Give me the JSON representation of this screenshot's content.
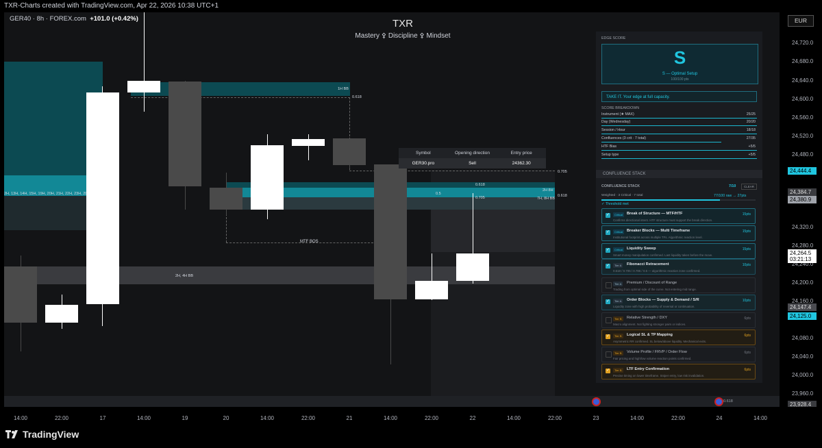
{
  "header": {
    "caption": "TXR-Charts created with TradingView.com, Apr 22, 2026 10:38 UTC+1",
    "symbol": "GER40 · 8h · FOREX.com",
    "change": "+101.0 (+0.42%)",
    "title": "TXR",
    "subtitle": "Mastery ⚴ Discipline ⚴ Mindset",
    "currency": "EUR"
  },
  "colors": {
    "accent": "#20c6e0",
    "zone_teal": "#0c4a52",
    "zone_bright": "#128896",
    "zone_gray": "#3a3b3f",
    "candle_bull": "#ffffff",
    "candle_bear": "#4a4a4a",
    "tier_s_gold": "#e0a020"
  },
  "zones": {
    "zone_1h": "1H BB",
    "zone_2h8h": "2H 8H",
    "zone_2h4h": "2H, 4H BB",
    "zone_7h8h": "7H, 8H BB",
    "left_label": "2H, 13H, 14H, 15H, 19H, 20H, 21H, 22H, 23H, 2D, 1",
    "fib_618_a": "0.618",
    "fib_618_b": "0.618",
    "fib_618_c": "0.618",
    "fib_705_a": "0.705",
    "fib_705_b": "0.705",
    "fib_5": "0.5",
    "mtf_bos": "MTF BOS",
    "fib_618_bottom": "0.618"
  },
  "trade_table": {
    "headers": [
      "Symbol",
      "Opening direction",
      "Entry price"
    ],
    "row": [
      "GER30.pro",
      "Sell",
      "24362.30"
    ]
  },
  "price_axis": {
    "labels": [
      "24,720.0",
      "24,680.0",
      "24,640.0",
      "24,600.0",
      "24,560.0",
      "24,520.0",
      "24,480.0",
      "24,320.0",
      "24,280.0",
      "24,240.0",
      "24,200.0",
      "24,160.0",
      "24,080.0",
      "24,040.0",
      "24,000.0",
      "23,960.0"
    ],
    "badges": {
      "p1": "24,444.4",
      "p2": "24,384.7",
      "p3": "24,380.9",
      "current": "24,264.5",
      "countdown": "03:21:13",
      "p4": "24,147.4",
      "p5": "24,125.0",
      "p6": "23,928.4"
    }
  },
  "time_axis": [
    "14:00",
    "22:00",
    "17",
    "14:00",
    "19",
    "20",
    "14:00",
    "22:00",
    "21",
    "14:00",
    "22:00",
    "22",
    "14:00",
    "22:00",
    "23",
    "14:00",
    "22:00",
    "24",
    "14:00"
  ],
  "edge_score": {
    "section": "EDGE SCORE",
    "grade": "S",
    "grade_label": "S — Optimal Setup",
    "points": "100/100 pts",
    "advice": "TAKE IT. Your edge at full capacity.",
    "breakdown_title": "SCORE BREAKDOWN",
    "breakdown": [
      {
        "label": "Instrument (★ MAX)",
        "value": "25/25",
        "fill": 1.0
      },
      {
        "label": "Day (Wednesday)",
        "value": "20/20",
        "fill": 1.0
      },
      {
        "label": "Session / Hour",
        "value": "18/18",
        "fill": 1.0
      },
      {
        "label": "Confluences (3 crit · 7 total)",
        "value": "27/35",
        "fill": 0.77
      },
      {
        "label": "HTF Bias",
        "value": "+5/5",
        "fill": 1.0
      },
      {
        "label": "Setup type",
        "value": "+5/5",
        "fill": 1.0
      }
    ]
  },
  "confluence": {
    "header": "CONFLUENCE STACK",
    "title": "CONFLUENCE STACK",
    "count": "7/10",
    "clear": "CLEAR",
    "weighted": "Weighted · 3 Critical · 7 total",
    "raw": "77/100 raw → 27pts",
    "threshold": "✓ Threshold met",
    "items": [
      {
        "tag": "Critical",
        "title": "Break of Structure — MTF/HTF",
        "desc": "Confirms directional intent. HTF structure must support the break direction.",
        "pts": "15pts",
        "checked": true,
        "tier": "crit"
      },
      {
        "tag": "Critical",
        "title": "Breaker Blocks — Multi Timeframe",
        "desc": "Institutional footprint across multiple TFs. Algorithmic reaction level.",
        "pts": "15pts",
        "checked": true,
        "tier": "crit"
      },
      {
        "tag": "Critical",
        "title": "Liquidity Sweep",
        "desc": "Smart money manipulation confirmed. Last liquidity taken before the move.",
        "pts": "15pts",
        "checked": true,
        "tier": "crit"
      },
      {
        "tag": "Tier A",
        "title": "Fibonacci Retracement",
        "desc": "0.618 / 0.705 / 0.786 / 0.5 — algorithmic reaction zone confirmed.",
        "pts": "10pts",
        "checked": true,
        "tier": "a"
      },
      {
        "tag": "Tier A",
        "title": "Premium / Discount of Range",
        "desc": "Trading from optimal side of the curve. Not entering mid range.",
        "pts": "",
        "checked": false,
        "tier": "a"
      },
      {
        "tag": "Tier A",
        "title": "Order Blocks — Supply & Demand / S/R",
        "desc": "Liquidity zone with high probability of reversal or continuation.",
        "pts": "10pts",
        "checked": true,
        "tier": "a"
      },
      {
        "tag": "Tier B",
        "title": "Relative Strength / DXY",
        "desc": "Macro alignment. Not fighting stronger pairs or indices.",
        "pts": "6pts",
        "checked": false,
        "tier": "b"
      },
      {
        "tag": "Tier B",
        "title": "Logical SL & TP Mapping",
        "desc": "Asymmetric RR confirmed. SL below/above liquidity. Mechanical exits.",
        "pts": "6pts",
        "checked": true,
        "tier": "b"
      },
      {
        "tag": "Tier B",
        "title": "Volume Profile / FRVP / Order Flow",
        "desc": "Fair pricing and high/low volume reaction points confirmed.",
        "pts": "6pts",
        "checked": false,
        "tier": "b"
      },
      {
        "tag": "Tier B",
        "title": "LTF Entry Confirmation",
        "desc": "Precise timing on lower timeframe. Sniper entry, low risk invalidation.",
        "pts": "6pts",
        "checked": true,
        "tier": "b"
      }
    ]
  },
  "footer": {
    "brand": "TradingView"
  }
}
